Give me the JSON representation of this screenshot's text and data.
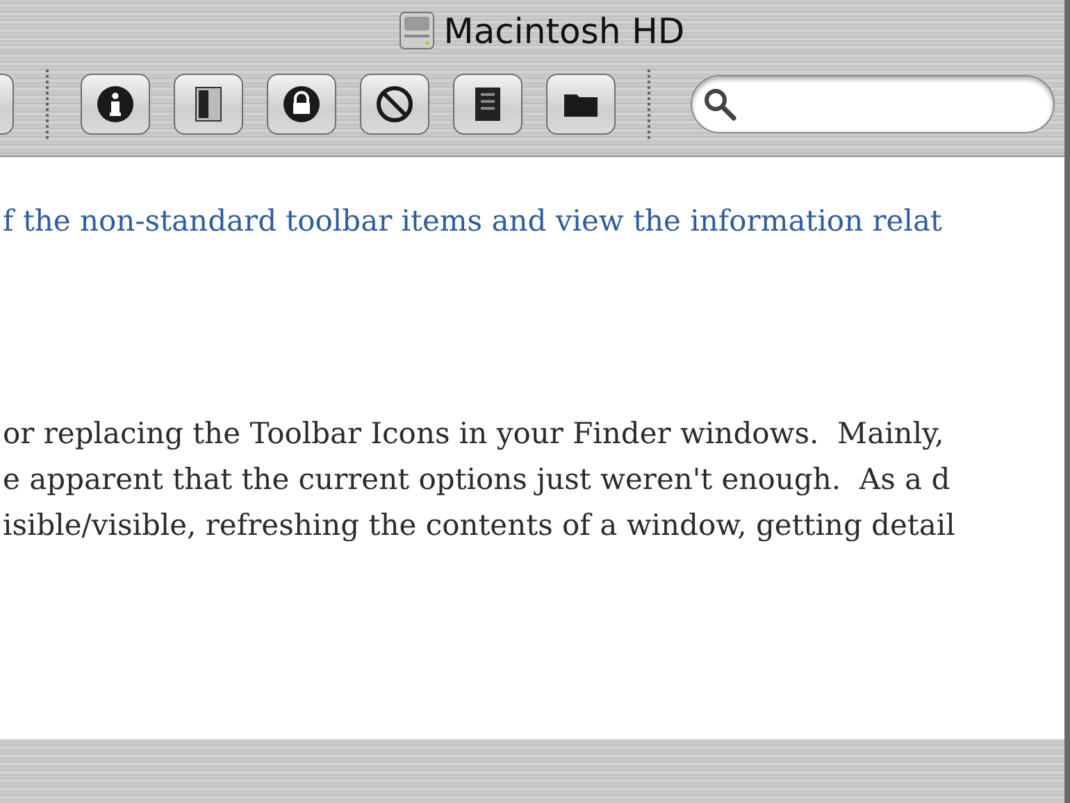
{
  "window": {
    "title": "Macintosh HD"
  },
  "content": {
    "lines": [
      {
        "kind": "link",
        "text": "f the non-standard toolbar items and view the information relat"
      },
      {
        "kind": "gap"
      },
      {
        "kind": "text",
        "text": "or replacing the Toolbar Icons in your Finder windows.  Mainly,"
      },
      {
        "kind": "text",
        "text": "e apparent that the current options just weren't enough.  As a d"
      },
      {
        "kind": "text",
        "text": "isible/visible, refreshing the contents of a window, getting detail"
      }
    ]
  }
}
